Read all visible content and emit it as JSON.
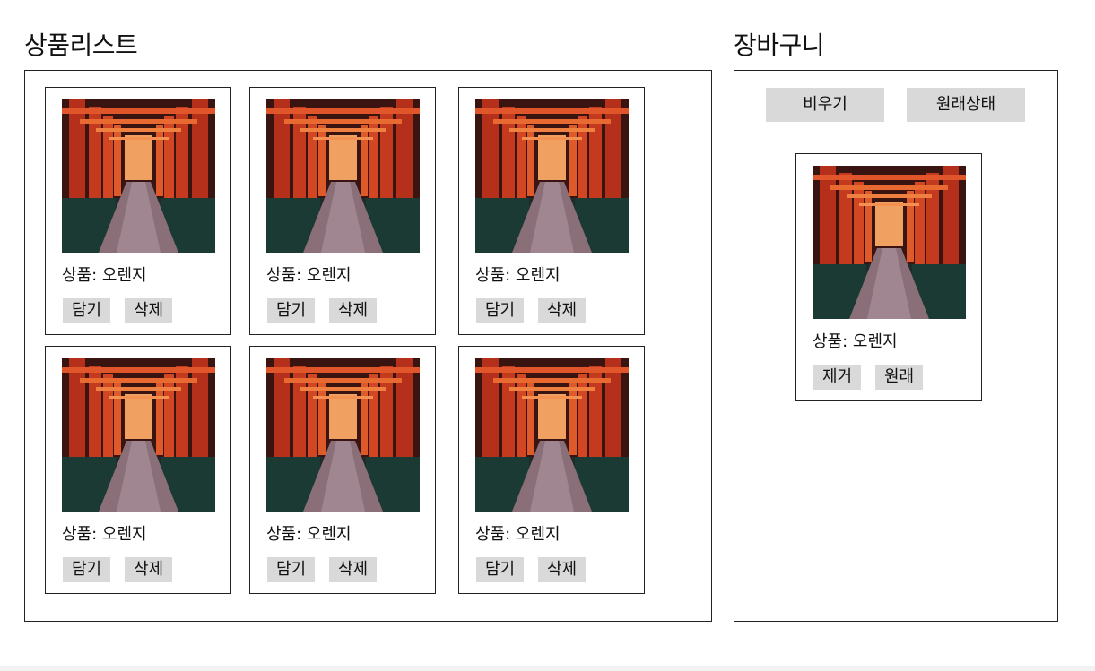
{
  "product_list": {
    "title": "상품리스트",
    "items": [
      {
        "name": "상품: 오렌지",
        "add_label": "담기",
        "delete_label": "삭제"
      },
      {
        "name": "상품: 오렌지",
        "add_label": "담기",
        "delete_label": "삭제"
      },
      {
        "name": "상품: 오렌지",
        "add_label": "담기",
        "delete_label": "삭제"
      },
      {
        "name": "상품: 오렌지",
        "add_label": "담기",
        "delete_label": "삭제"
      },
      {
        "name": "상품: 오렌지",
        "add_label": "담기",
        "delete_label": "삭제"
      },
      {
        "name": "상품: 오렌지",
        "add_label": "담기",
        "delete_label": "삭제"
      }
    ]
  },
  "cart": {
    "title": "장바구니",
    "clear_label": "비우기",
    "reset_label": "원래상태",
    "items": [
      {
        "name": "상품: 오렌지",
        "remove_label": "제거",
        "restore_label": "원래"
      }
    ]
  },
  "colors": {
    "button_bg": "#d9d9d9",
    "border": "#222222",
    "torii_red": "#c8361c"
  }
}
